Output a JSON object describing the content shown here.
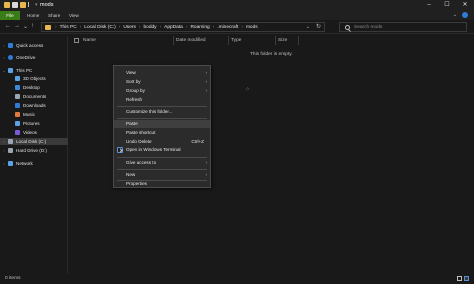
{
  "window": {
    "title": "mods",
    "controls": {
      "minimize": "–",
      "maximize": "☐",
      "close": "✕"
    }
  },
  "ribbon": {
    "tabs": [
      "File",
      "Home",
      "Share",
      "View"
    ],
    "expand_icon": "chevron-down-icon",
    "help_icon": "help-icon"
  },
  "addressbar": {
    "nav": {
      "back": "←",
      "forward": "→",
      "recent": "⌄",
      "up": "↑"
    },
    "breadcrumbs": [
      "This PC",
      "Local Disk (C:)",
      "Users",
      "boddy",
      "AppData",
      "Roaming",
      ".minecraft",
      "mods"
    ],
    "separator": "›",
    "dropdown": "⌄",
    "refresh": "↻"
  },
  "search": {
    "placeholder": "Search mods"
  },
  "nav_pane": {
    "items": [
      {
        "label": "Quick access",
        "icon": "star-icon",
        "color": "#2f7bd6",
        "caret": "›"
      },
      {
        "label": "OneDrive",
        "icon": "cloud-icon",
        "color": "#2f7bd6",
        "caret": "›"
      },
      {
        "label": "This PC",
        "icon": "computer-icon",
        "color": "#5aa3e8",
        "caret": "⌄"
      },
      {
        "label": "3D Objects",
        "icon": "cube-icon",
        "color": "#5aa3e8",
        "caret": ""
      },
      {
        "label": "Desktop",
        "icon": "desktop-icon",
        "color": "#3b8ad9",
        "caret": ""
      },
      {
        "label": "Documents",
        "icon": "documents-icon",
        "color": "#9aa6b2",
        "caret": ""
      },
      {
        "label": "Downloads",
        "icon": "download-icon",
        "color": "#2f7bd6",
        "caret": ""
      },
      {
        "label": "Music",
        "icon": "music-icon",
        "color": "#e07a3c",
        "caret": ""
      },
      {
        "label": "Pictures",
        "icon": "pictures-icon",
        "color": "#5aa3e8",
        "caret": ""
      },
      {
        "label": "Videos",
        "icon": "videos-icon",
        "color": "#7a5ad6",
        "caret": ""
      },
      {
        "label": "Local Disk (C:)",
        "icon": "drive-icon",
        "color": "#9aa6b2",
        "caret": "›"
      },
      {
        "label": "Hard Drive (D:)",
        "icon": "drive-icon",
        "color": "#9aa6b2",
        "caret": "›"
      },
      {
        "label": "Network",
        "icon": "network-icon",
        "color": "#5aa3e8",
        "caret": "›"
      }
    ]
  },
  "content": {
    "columns": [
      "Name",
      "Date modified",
      "Type",
      "Size"
    ],
    "empty_message": "This folder is empty."
  },
  "context_menu": {
    "items": [
      {
        "label": "View",
        "submenu": true
      },
      {
        "label": "Sort by",
        "submenu": true
      },
      {
        "label": "Group by",
        "submenu": true
      },
      {
        "label": "Refresh",
        "submenu": false
      },
      {
        "label": "Customize this folder...",
        "submenu": false
      },
      {
        "label": "Paste",
        "submenu": false,
        "hover": true
      },
      {
        "label": "Paste shortcut",
        "submenu": false
      },
      {
        "label": "Undo Delete",
        "submenu": false,
        "shortcut": "Ctrl+Z"
      },
      {
        "label": "Open in Windows Terminal",
        "submenu": false,
        "icon": "terminal-icon"
      },
      {
        "label": "Give access to",
        "submenu": true
      },
      {
        "label": "New",
        "submenu": true
      },
      {
        "label": "Properties",
        "submenu": false
      }
    ]
  },
  "statusbar": {
    "item_count": "0 items"
  }
}
